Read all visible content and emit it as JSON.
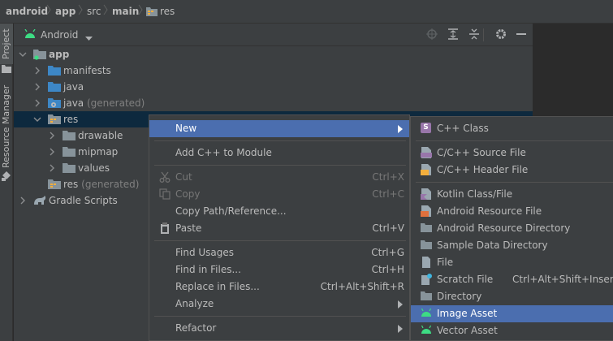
{
  "breadcrumb": [
    "android",
    "app",
    "src",
    "main",
    "res"
  ],
  "tool_tabs": {
    "project": "Project",
    "resource_manager": "Resource Manager"
  },
  "panel": {
    "view_mode": "Android"
  },
  "tree": {
    "app": "app",
    "manifests": "manifests",
    "java": "java",
    "java_generated_name": "java",
    "java_generated_suffix": "(generated)",
    "res": "res",
    "drawable": "drawable",
    "mipmap": "mipmap",
    "values": "values",
    "res_generated_name": "res",
    "res_generated_suffix": "(generated)",
    "gradle_scripts": "Gradle Scripts"
  },
  "context_menu": {
    "new": "New",
    "add_cpp": "Add C++ to Module",
    "cut": "Cut",
    "cut_sc": "Ctrl+X",
    "copy": "Copy",
    "copy_sc": "Ctrl+C",
    "copy_path": "Copy Path/Reference...",
    "paste": "Paste",
    "paste_sc": "Ctrl+V",
    "find_usages": "Find Usages",
    "find_usages_sc": "Ctrl+G",
    "find_in_files": "Find in Files...",
    "find_in_files_sc": "Ctrl+H",
    "replace_in_files": "Replace in Files...",
    "replace_in_files_sc": "Ctrl+Alt+Shift+R",
    "analyze": "Analyze",
    "refactor": "Refactor"
  },
  "submenu": {
    "cpp_class": "C++ Class",
    "cpp_source": "C/C++ Source File",
    "cpp_header": "C/C++ Header File",
    "kotlin": "Kotlin Class/File",
    "android_resource_file": "Android Resource File",
    "android_resource_dir": "Android Resource Directory",
    "sample_data_dir": "Sample Data Directory",
    "file": "File",
    "scratch": "Scratch File",
    "scratch_sc": "Ctrl+Alt+Shift+Insert",
    "directory": "Directory",
    "image_asset": "Image Asset",
    "vector_asset": "Vector Asset"
  },
  "colors": {
    "background": "#2b2b2b",
    "panel": "#3c3f41",
    "selection": "#0d293e",
    "menu_highlight": "#4b6eaf",
    "folder": "#87939a",
    "folder_blue": "#3d87c6",
    "android_green": "#3ddc84"
  }
}
